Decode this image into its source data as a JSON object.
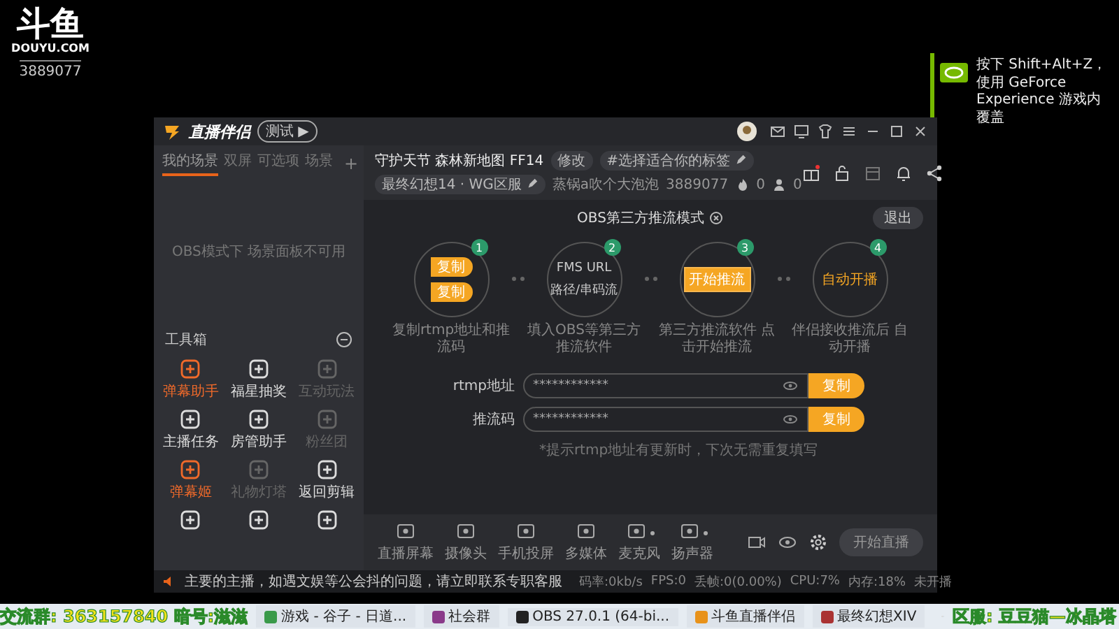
{
  "stream_overlay": {
    "logo": "斗鱼",
    "site": "DOUYU.COM",
    "room_id": "3889077",
    "left_banner": "交流群: 363157840 暗号:滋滋",
    "right_banner": "区服: 豆豆猫—冰晶塔"
  },
  "notification": {
    "text": "按下 Shift+Alt+Z，使用 GeForce Experience 游戏内覆盖"
  },
  "app": {
    "title": "直播伴侣",
    "badge": "测试 ▶",
    "scene_tabs": [
      {
        "label": "我的场景",
        "selected": true
      },
      {
        "label": "双屏",
        "selected": false
      },
      {
        "label": "可选项",
        "selected": false
      },
      {
        "label": "场景",
        "selected": false
      }
    ],
    "add_tab": "+",
    "scene_empty": "OBS模式下 场景面板不可用",
    "toolbox_title": "工具箱",
    "tools": [
      {
        "label": "弹幕助手",
        "highlighted": true,
        "disabled": false
      },
      {
        "label": "福星抽奖",
        "highlighted": false,
        "disabled": false
      },
      {
        "label": "互动玩法",
        "highlighted": false,
        "disabled": true
      },
      {
        "label": "主播任务",
        "highlighted": false,
        "disabled": false
      },
      {
        "label": "房管助手",
        "highlighted": false,
        "disabled": false
      },
      {
        "label": "粉丝团",
        "highlighted": false,
        "disabled": true
      },
      {
        "label": "弹幕姬",
        "highlighted": true,
        "disabled": false
      },
      {
        "label": "礼物灯塔",
        "highlighted": false,
        "disabled": true
      },
      {
        "label": "返回剪辑",
        "highlighted": false,
        "disabled": false
      },
      {
        "highlighted": false,
        "disabled": false
      },
      {
        "highlighted": false,
        "disabled": false
      },
      {
        "highlighted": false,
        "disabled": false
      }
    ],
    "notice": "主要的主播，如遇文娱等公会抖的问题，请立即联系专职客服",
    "header": {
      "stream_title": "守护天节 森林新地图 FF14",
      "edit_button": "修改",
      "tag_field": "#选择适合你的标签",
      "category": "最终幻想14 · WG区服",
      "streamer": "蒸锅a吹个大泡泡",
      "room": "3889077",
      "hot": "0",
      "fans": "0"
    },
    "obs_panel": {
      "title": "OBS第三方推流模式",
      "exit_button": "退出",
      "steps": [
        {
          "kind": "copy",
          "number": "1",
          "buttons": [
            "复制",
            "复制"
          ],
          "caption": "复制rtmp地址和推流码"
        },
        {
          "kind": "fill",
          "number": "2",
          "lines": [
            "FMS URL",
            "路径/串码流"
          ],
          "caption": "填入OBS等第三方推流软件"
        },
        {
          "kind": "start",
          "number": "3",
          "button": "开始推流",
          "caption": "第三方推流软件 点击开始推流"
        },
        {
          "kind": "auto",
          "number": "4",
          "text": "自动开播",
          "caption": "伴侣接收推流后 自动开播"
        }
      ],
      "fields": [
        {
          "label": "rtmp地址",
          "value": "************",
          "button": "复制"
        },
        {
          "label": "推流码",
          "value": "************",
          "button": "复制"
        }
      ],
      "hint": "*提示rtmp地址有更新时，下次无需重复填写"
    },
    "toolbar": [
      {
        "label": "直播屏幕",
        "dropdown": false
      },
      {
        "label": "摄像头",
        "dropdown": false
      },
      {
        "label": "手机投屏",
        "dropdown": false
      },
      {
        "label": "多媒体",
        "dropdown": false
      },
      {
        "label": "麦克风",
        "dropdown": true
      },
      {
        "label": "扬声器",
        "dropdown": true
      }
    ],
    "start_button": "开始直播",
    "status_bar": [
      "码率:0kb/s",
      "FPS:0",
      "丢帧:0(0.00%)",
      "CPU:7%",
      "内存:18%",
      "未开播"
    ]
  },
  "taskbar": [
    {
      "label": "游戏 - 谷子 - 日道..."
    },
    {
      "label": "社会群"
    },
    {
      "label": "OBS 27.0.1 (64-bi..."
    },
    {
      "label": "斗鱼直播伴侣"
    },
    {
      "label": "最终幻想XIV"
    }
  ]
}
